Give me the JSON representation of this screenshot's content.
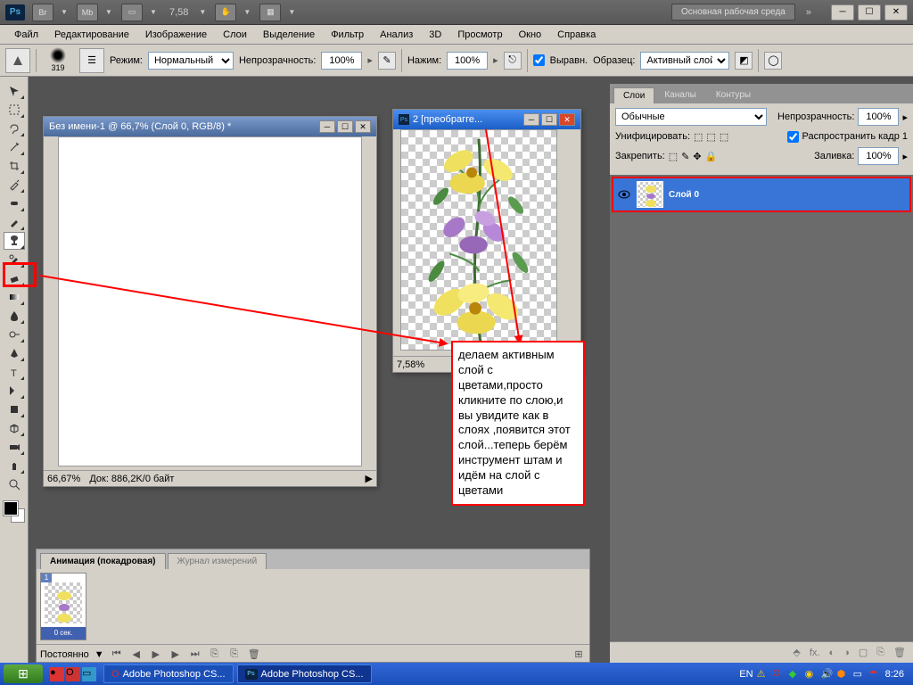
{
  "titlebar": {
    "zoom": "7,58",
    "workspace": "Основная рабочая среда"
  },
  "menu": [
    "Файл",
    "Редактирование",
    "Изображение",
    "Слои",
    "Выделение",
    "Фильтр",
    "Анализ",
    "3D",
    "Просмотр",
    "Окно",
    "Справка"
  ],
  "options": {
    "brush_size": "319",
    "mode_label": "Режим:",
    "mode": "Нормальный",
    "opacity_label": "Непрозрачность:",
    "opacity": "100%",
    "flow_label": "Нажим:",
    "flow": "100%",
    "aligned": "Выравн.",
    "sample_label": "Образец:",
    "sample": "Активный слой"
  },
  "doc1": {
    "title": "Без имени-1 @ 66,7% (Слой 0, RGB/8) *",
    "zoom": "66,67%",
    "status": "Док: 886,2K/0 байт"
  },
  "doc2": {
    "title": "2 [преобрагге...",
    "zoom": "7,58%"
  },
  "animation": {
    "tab1": "Анимация (покадровая)",
    "tab2": "Журнал измерений",
    "frame_dur": "0 сек.",
    "loop": "Постоянно"
  },
  "layers": {
    "tab1": "Слои",
    "tab2": "Каналы",
    "tab3": "Контуры",
    "blend": "Обычные",
    "opacity_label": "Непрозрачность:",
    "opacity": "100%",
    "unify": "Унифицировать:",
    "propagate": "Распространить кадр 1",
    "lock_label": "Закрепить:",
    "fill_label": "Заливка:",
    "fill": "100%",
    "layer0": "Слой 0"
  },
  "annotation": "делаем активным слой с цветами,просто кликните по слою,и вы увидите как в слоях ,появится этот слой...теперь берём инструмент штам и идём на слой с цветами",
  "taskbar": {
    "app1": "Adobe Photoshop CS...",
    "app2": "Adobe Photoshop CS...",
    "lang": "EN",
    "time": "8:26"
  }
}
